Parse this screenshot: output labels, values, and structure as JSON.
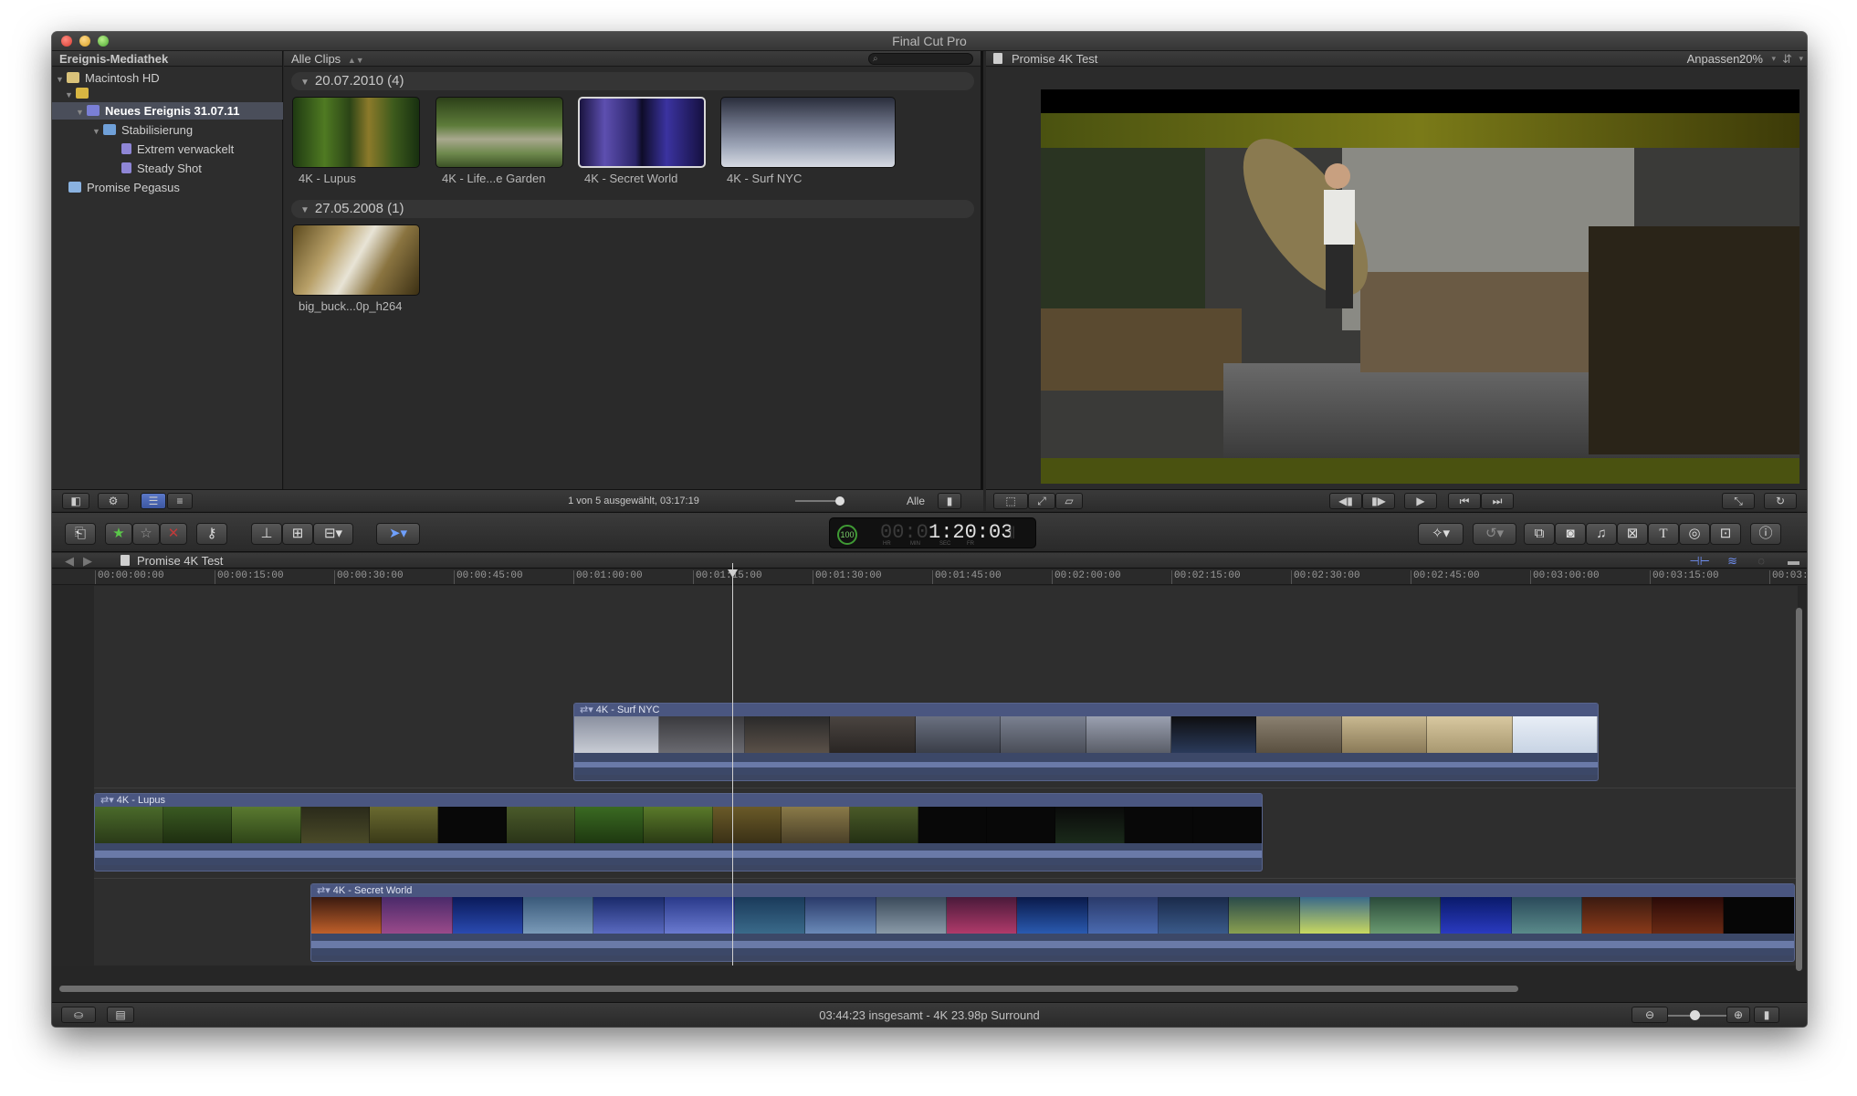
{
  "window": {
    "title": "Final Cut Pro"
  },
  "library": {
    "header": "Ereignis-Mediathek",
    "items": [
      {
        "label": "Macintosh HD"
      },
      {
        "label": ""
      },
      {
        "label": "Neues Ereignis 31.07.11"
      },
      {
        "label": "Stabilisierung"
      },
      {
        "label": "Extrem verwackelt"
      },
      {
        "label": "Steady Shot"
      },
      {
        "label": "Promise Pegasus"
      }
    ]
  },
  "browser": {
    "filter_label": "Alle Clips",
    "groups": [
      {
        "title": "20.07.2010  (4)",
        "clips": [
          {
            "label": "4K - Lupus"
          },
          {
            "label": "4K - Life...e Garden"
          },
          {
            "label": "4K - Secret World"
          },
          {
            "label": "4K - Surf NYC"
          }
        ]
      },
      {
        "title": "27.05.2008  (1)",
        "clips": [
          {
            "label": "big_buck...0p_h264"
          }
        ]
      }
    ],
    "footer_status": "1 von 5 ausgewählt, 03:17:19",
    "footer_filter": "Alle"
  },
  "viewer": {
    "title": "Promise 4K Test",
    "fit_label": "Anpassen:",
    "zoom": "20%"
  },
  "toolbar": {
    "timecode": "1:20:03",
    "timecode_dim": "00:0",
    "tc_units": [
      "HR",
      "MIN",
      "SEC",
      "FR"
    ],
    "percent": "100"
  },
  "timeline": {
    "project": "Promise 4K Test",
    "ruler": [
      "00:00:00:00",
      "00:00:15:00",
      "00:00:30:00",
      "00:00:45:00",
      "00:01:00:00",
      "00:01:15:00",
      "00:01:30:00",
      "00:01:45:00",
      "00:02:00:00",
      "00:02:15:00",
      "00:02:30:00",
      "00:02:45:00",
      "00:03:00:00",
      "00:03:15:00",
      "00:03:"
    ],
    "clips": [
      {
        "name": "4K - Surf NYC"
      },
      {
        "name": "4K - Lupus"
      },
      {
        "name": "4K - Secret World"
      }
    ],
    "status": "03:44:23 insgesamt - 4K 23.98p Surround"
  }
}
